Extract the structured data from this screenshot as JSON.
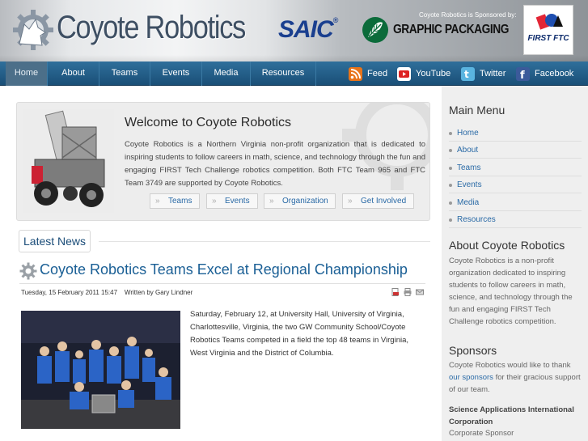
{
  "header": {
    "site_title": "Coyote Robotics",
    "sponsor_note": "Coyote Robotics is Sponsored by:",
    "sponsor1": "SAIC",
    "sponsor2": "GRAPHIC PACKAGING",
    "first_badge": "FIRST FTC"
  },
  "nav": {
    "items": [
      {
        "label": "Home"
      },
      {
        "label": "About"
      },
      {
        "label": "Teams"
      },
      {
        "label": "Events"
      },
      {
        "label": "Media"
      },
      {
        "label": "Resources"
      }
    ],
    "social": [
      {
        "label": "Feed",
        "icon": "rss-icon"
      },
      {
        "label": "YouTube",
        "icon": "youtube-icon"
      },
      {
        "label": "Twitter",
        "icon": "twitter-icon"
      },
      {
        "label": "Facebook",
        "icon": "facebook-icon"
      }
    ]
  },
  "welcome": {
    "title": "Welcome to Coyote Robotics",
    "text": "Coyote Robotics is a Northern Virginia non-profit organization that is dedicated to inspiring students to follow careers in math, science, and technology through the fun and engaging FIRST Tech Challenge robotics competition. Both FTC Team 965 and FTC Team 3749 are supported by Coyote Robotics.",
    "buttons": [
      {
        "label": "Teams"
      },
      {
        "label": "Events"
      },
      {
        "label": "Organization"
      },
      {
        "label": "Get Involved"
      }
    ]
  },
  "news": {
    "heading": "Latest News",
    "article": {
      "title": "Coyote Robotics Teams Excel at Regional Championship",
      "meta": "Tuesday, 15 February 2011 15:47    Written by Gary Lindner",
      "body": "Saturday, February 12, at University Hall, University of Virginia, Charlottesville, Virginia, the two GW Community School/Coyote Robotics Teams competed in a field the top 48 teams in Virginia, West Virginia and the District of Columbia."
    }
  },
  "sidebar": {
    "main_menu_title": "Main Menu",
    "menu": [
      {
        "label": "Home"
      },
      {
        "label": "About"
      },
      {
        "label": "Teams"
      },
      {
        "label": "Events"
      },
      {
        "label": "Media"
      },
      {
        "label": "Resources"
      }
    ],
    "about_title": "About Coyote Robotics",
    "about_text": "Coyote Robotics is a non-profit organization dedicated to inspiring students to follow careers in math, science, and technology through the fun and engaging FIRST Tech Challenge robotics competition.",
    "sponsors_title": "Sponsors",
    "sponsors_text_before": "Coyote Robotics would like to thank",
    "sponsors_link": "our sponsors",
    "sponsors_text_after": "for their gracious support of our team.",
    "sponsor_name": "Science Applications International Corporation",
    "sponsor_role": "Corporate Sponsor"
  },
  "colors": {
    "nav_bg": "#1f5b86",
    "link": "#2a6aa6",
    "title_blue": "#1a5f95"
  }
}
